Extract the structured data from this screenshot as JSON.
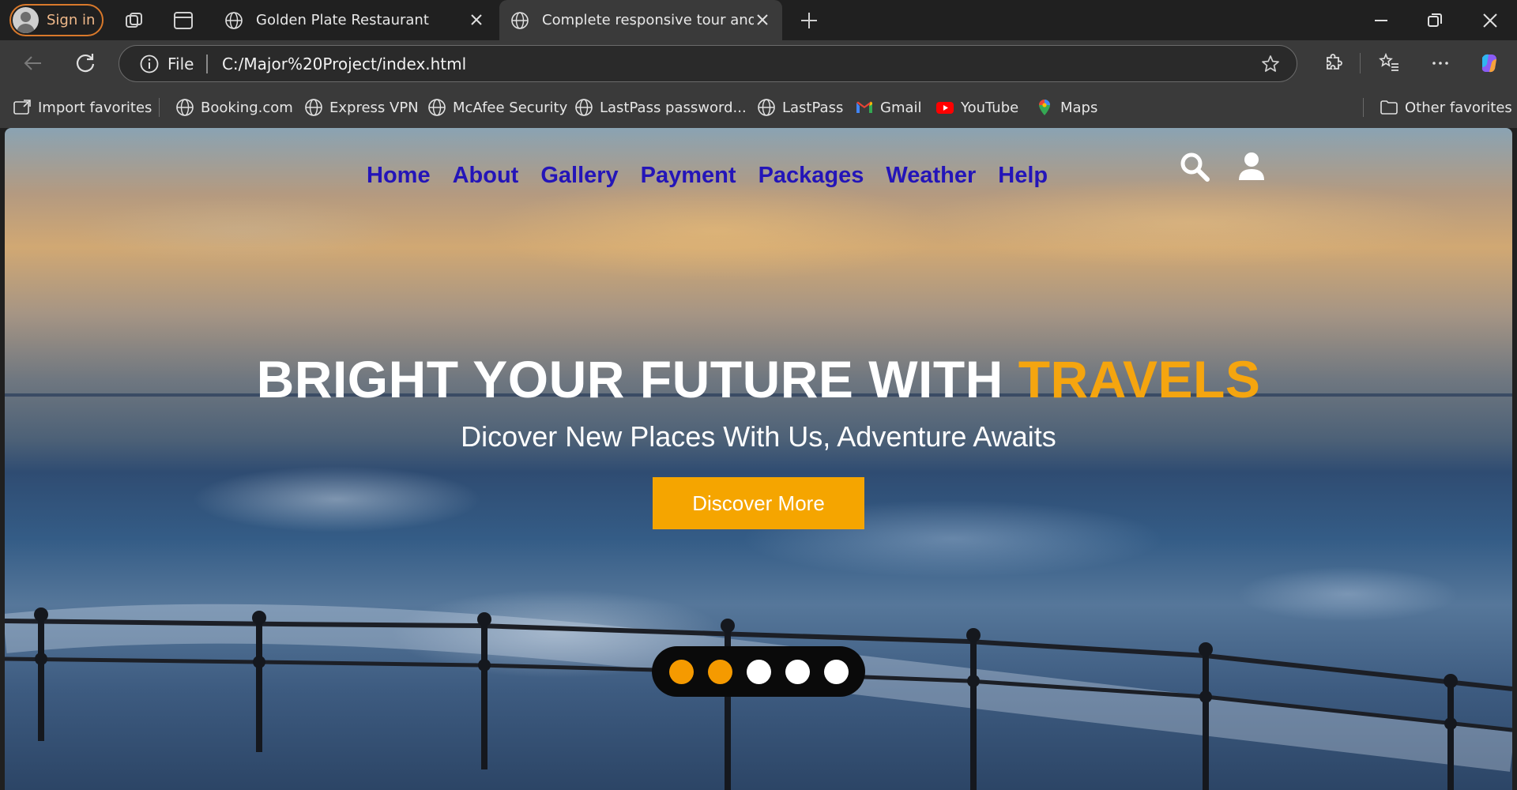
{
  "browser": {
    "signin_label": "Sign in",
    "tabs": [
      {
        "title": "Golden Plate Restaurant",
        "active": false
      },
      {
        "title": "Complete responsive tour and tra",
        "active": true
      }
    ],
    "address": {
      "scheme_label": "File",
      "url": "C:/Major%20Project/index.html"
    },
    "favorites": [
      {
        "label": "Import favorites",
        "icon": "import-icon"
      },
      {
        "label": "Booking.com",
        "icon": "globe-icon"
      },
      {
        "label": "Express VPN",
        "icon": "globe-icon"
      },
      {
        "label": "McAfee Security",
        "icon": "globe-icon"
      },
      {
        "label": "LastPass password...",
        "icon": "globe-icon"
      },
      {
        "label": "LastPass",
        "icon": "globe-icon"
      },
      {
        "label": "Gmail",
        "icon": "gmail-icon"
      },
      {
        "label": "YouTube",
        "icon": "youtube-icon"
      },
      {
        "label": "Maps",
        "icon": "maps-icon"
      }
    ],
    "other_favorites": "Other favorites"
  },
  "site": {
    "nav": [
      "Home",
      "About",
      "Gallery",
      "Payment",
      "Packages",
      "Weather",
      "Help"
    ],
    "hero": {
      "title_main": "BRIGHT YOUR FUTURE WITH ",
      "title_accent": "TRAVELS",
      "subtitle": "Dicover New Places With Us, Adventure Awaits",
      "button": "Discover More"
    },
    "slider": {
      "total": 5,
      "active": [
        1,
        2
      ]
    },
    "colors": {
      "nav_link": "#2415b8",
      "accent": "#f5a50f",
      "button": "#f5a500"
    }
  }
}
